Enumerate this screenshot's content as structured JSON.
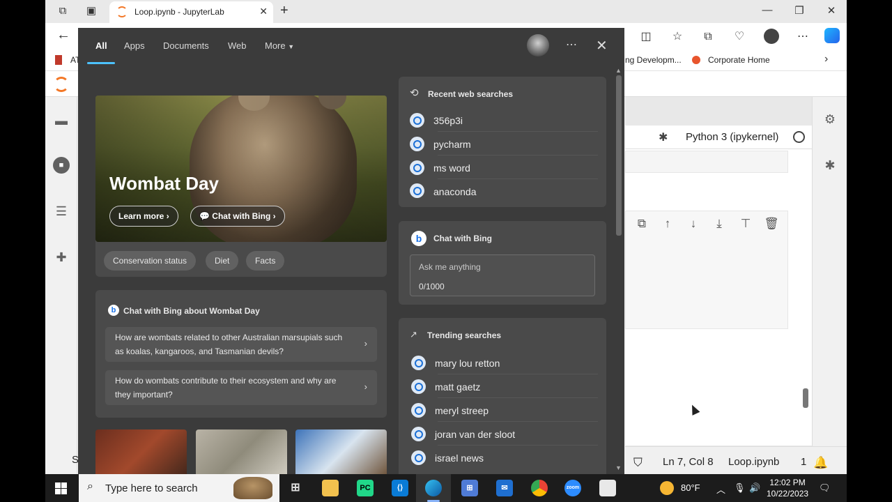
{
  "browser": {
    "tab_title": "Loop.ipynb - JupyterLab",
    "favorites": [
      {
        "label": "AT"
      },
      {
        "label": "ng Developm..."
      },
      {
        "label": "Corporate Home"
      }
    ]
  },
  "jupyter": {
    "kernel": "Python 3 (ipykernel)",
    "status": {
      "position": "Ln 7, Col 8",
      "file": "Loop.ipynb",
      "count": "1"
    },
    "left_partial_text": "S"
  },
  "search_panel": {
    "tabs": [
      "All",
      "Apps",
      "Documents",
      "Web",
      "More"
    ],
    "hero": {
      "title": "Wombat Day",
      "learn_more": "Learn more",
      "chat_btn": "Chat with Bing",
      "chips": [
        "Conservation status",
        "Diet",
        "Facts"
      ]
    },
    "chat_about": {
      "title": "Chat with Bing about Wombat Day",
      "questions": [
        "How are wombats related to other Australian marsupials such as koalas, kangaroos, and Tasmanian devils?",
        "How do wombats contribute to their ecosystem and why are they important?"
      ]
    },
    "recent": {
      "title": "Recent web searches",
      "items": [
        "356p3i",
        "pycharm",
        "ms word",
        "anaconda"
      ]
    },
    "chat": {
      "title": "Chat with Bing",
      "placeholder": "Ask me anything",
      "counter": "0/1000"
    },
    "trending": {
      "title": "Trending searches",
      "items": [
        "mary lou retton",
        "matt gaetz",
        "meryl streep",
        "joran van der sloot",
        "israel news"
      ]
    }
  },
  "taskbar": {
    "search_placeholder": "Type here to search",
    "weather": "80°F",
    "time": "12:02 PM",
    "date": "10/22/2023",
    "apps": [
      "PC",
      "zoom"
    ]
  }
}
